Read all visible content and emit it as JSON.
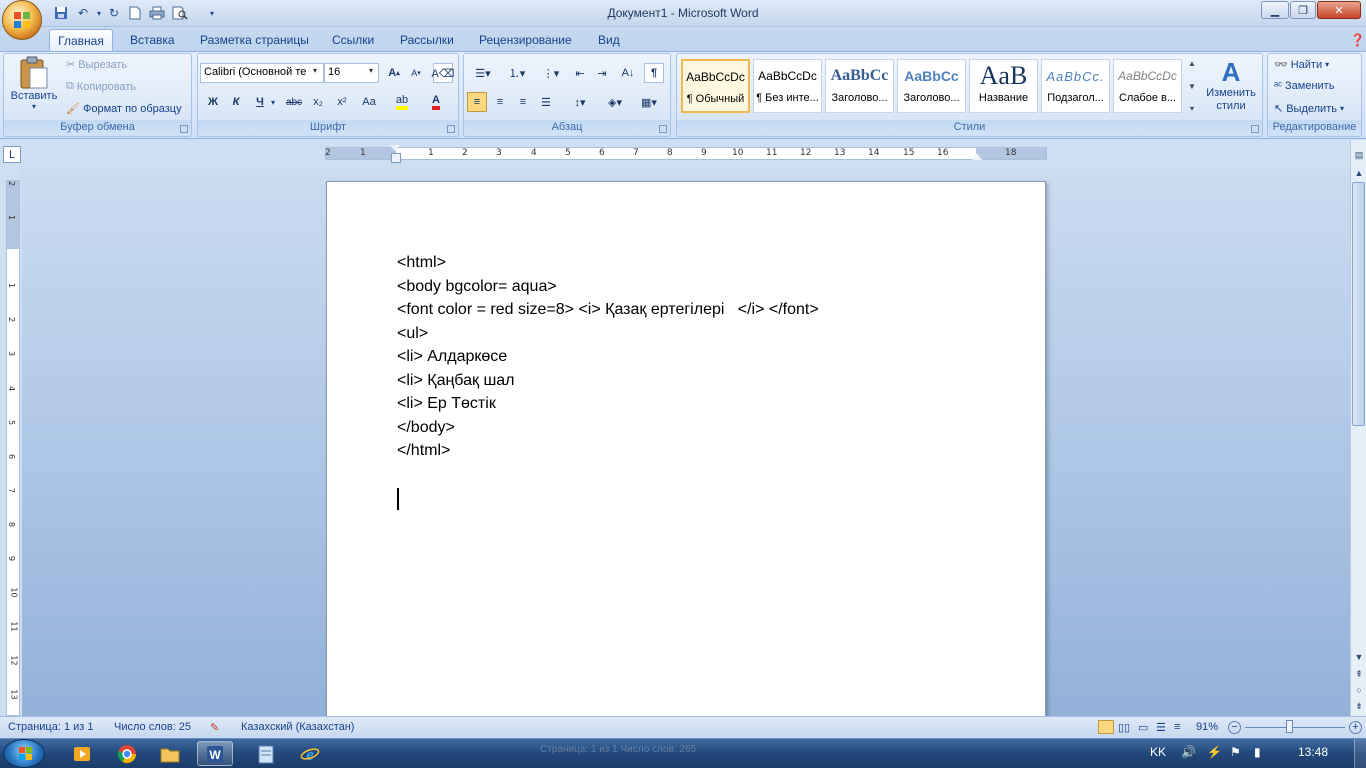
{
  "window": {
    "title": "Документ1 - Microsoft Word"
  },
  "tabs": [
    "Главная",
    "Вставка",
    "Разметка страницы",
    "Ссылки",
    "Рассылки",
    "Рецензирование",
    "Вид"
  ],
  "clipboard": {
    "paste": "Вставить",
    "cut": "Вырезать",
    "copy": "Копировать",
    "format_painter": "Формат по образцу",
    "label": "Буфер обмена"
  },
  "font": {
    "name": "Calibri (Основной те",
    "size": "16",
    "bold": "Ж",
    "italic": "К",
    "underline": "Ч",
    "strike": "abc",
    "sub": "x₂",
    "sup": "x²",
    "case": "Aa",
    "label": "Шрифт"
  },
  "paragraph": {
    "label": "Абзац"
  },
  "styles": {
    "label": "Стили",
    "items": [
      {
        "sample": "AaBbCcDc",
        "name": "¶ Обычный"
      },
      {
        "sample": "AaBbCcDc",
        "name": "¶ Без инте..."
      },
      {
        "sample": "AaBbCc",
        "name": "Заголово..."
      },
      {
        "sample": "AaBbCc",
        "name": "Заголово..."
      },
      {
        "sample": "AaB",
        "name": "Название"
      },
      {
        "sample": "AaBbCc.",
        "name": "Подзагол..."
      },
      {
        "sample": "AaBbCcDc",
        "name": "Слабое в..."
      }
    ],
    "change": "Изменить стили"
  },
  "editing": {
    "find": "Найти",
    "replace": "Заменить",
    "select": "Выделить",
    "label": "Редактирование"
  },
  "ruler": {
    "h_numbers": [
      "2",
      "1",
      "1",
      "2",
      "3",
      "4",
      "5",
      "6",
      "7",
      "8",
      "9",
      "10",
      "11",
      "12",
      "13",
      "14",
      "15",
      "16",
      "18"
    ],
    "v_numbers": [
      "2",
      "1",
      "1",
      "2",
      "3",
      "4",
      "5",
      "6",
      "7",
      "8",
      "9",
      "10",
      "11",
      "12",
      "13"
    ]
  },
  "document": {
    "lines": [
      "<html>",
      "<body bgcolor= aqua>",
      "<font color = red size=8> <i> Қазақ ертегілері   </i> </font>",
      "<ul>",
      "<li> Алдаркөсе",
      "<li> Қаңбақ шал",
      "<li> Ер Төстік",
      "</body>",
      "</html>"
    ]
  },
  "status": {
    "page": "Страница: 1 из 1",
    "words": "Число слов: 25",
    "language": "Казахский (Казахстан)",
    "zoom": "91%"
  },
  "taskbar": {
    "lang": "KK",
    "time": "13:48",
    "ghost": "Страница: 1 из 1    Число слов: 265"
  }
}
